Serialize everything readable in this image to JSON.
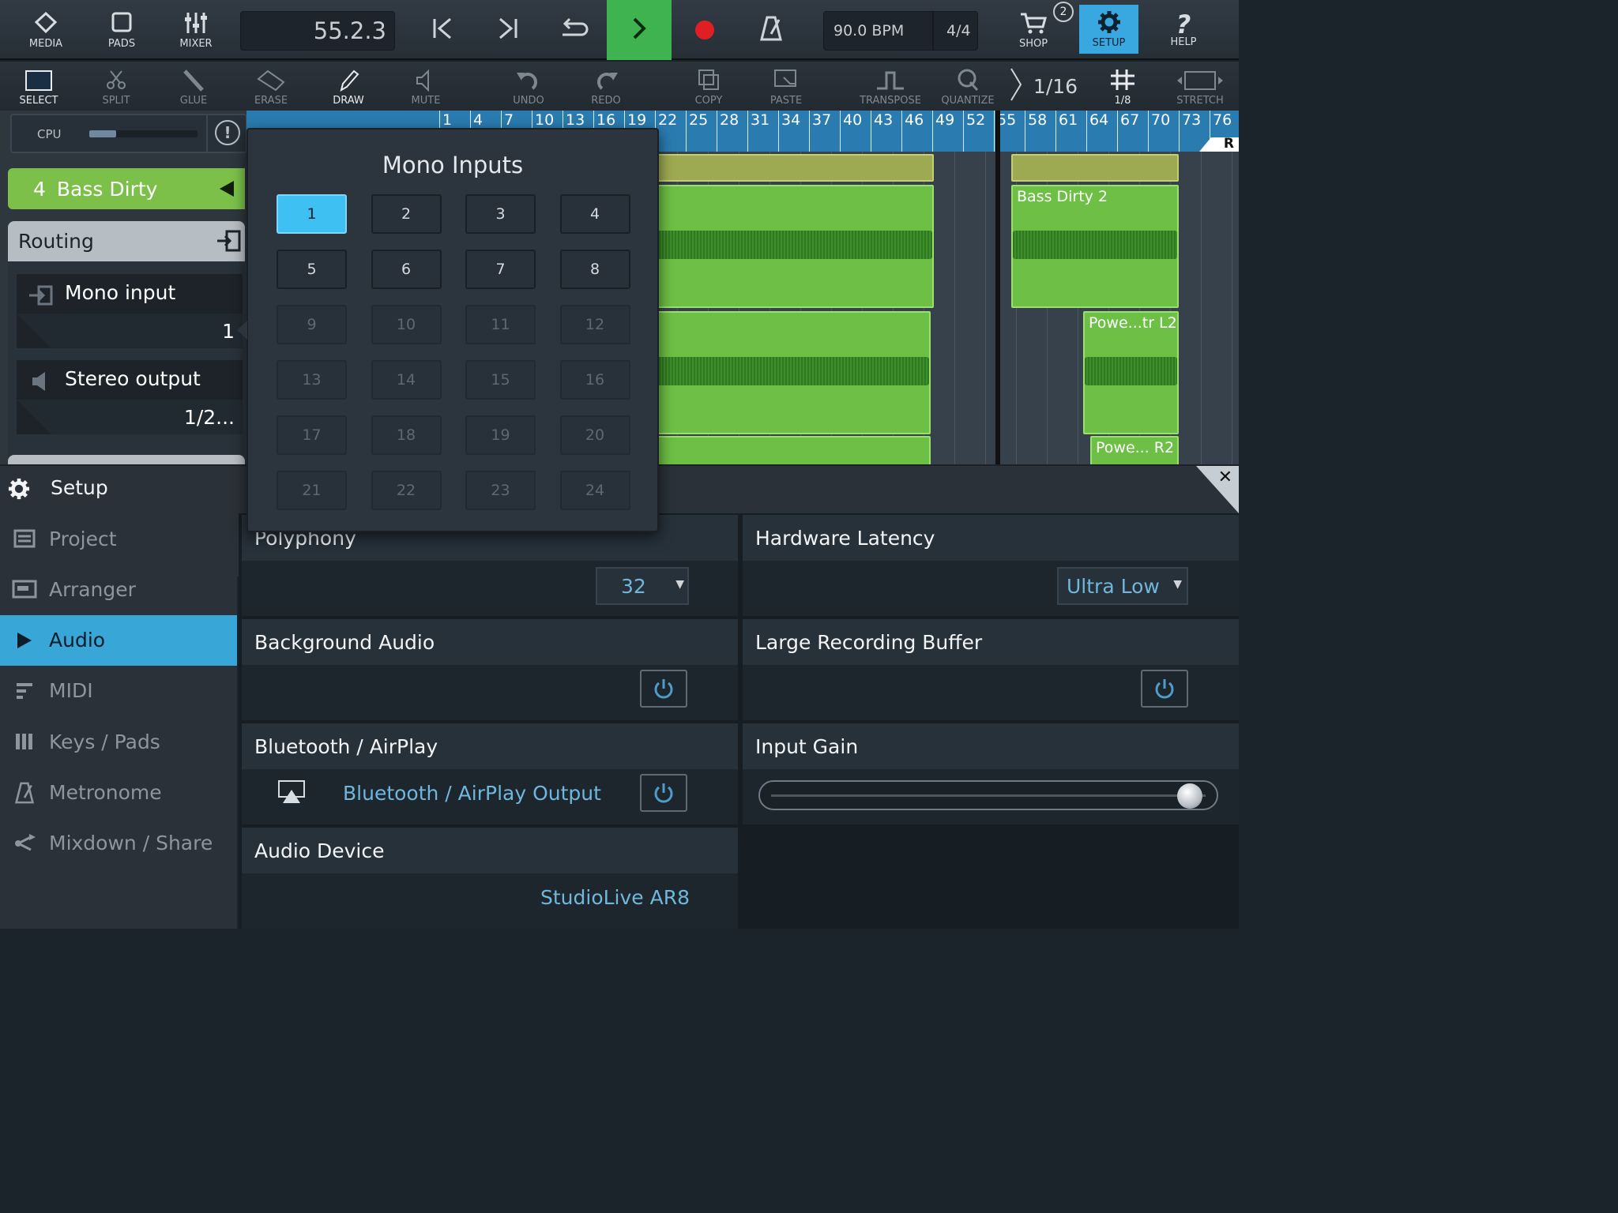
{
  "topbar": {
    "media": "MEDIA",
    "pads": "PADS",
    "mixer": "MIXER",
    "position": "55.2.3",
    "tempo": "90.0 BPM",
    "signature": "4/4",
    "shop": "SHOP",
    "shop_badge": "2",
    "setup": "SETUP",
    "help": "HELP"
  },
  "toolbar": {
    "select": "SELECT",
    "split": "SPLIT",
    "glue": "GLUE",
    "erase": "ERASE",
    "draw": "DRAW",
    "mute": "MUTE",
    "undo": "UNDO",
    "redo": "REDO",
    "copy": "COPY",
    "paste": "PASTE",
    "transpose": "TRANSPOSE",
    "quantize": "QUANTIZE",
    "quantize_value": "1/16",
    "grid_value": "1/8",
    "stretch": "STRETCH"
  },
  "track": {
    "cpu_label": "CPU",
    "cpu_level": 0.25,
    "number": "4",
    "name": "Bass Dirty",
    "routing_label": "Routing",
    "input_label": "Mono input",
    "input_value": "1",
    "output_label": "Stereo output",
    "output_value": "1/2..."
  },
  "ruler": {
    "bars": [
      "1",
      "4",
      "7",
      "10",
      "13",
      "16",
      "19",
      "22",
      "25",
      "28",
      "31",
      "34",
      "37",
      "40",
      "43",
      "46",
      "49",
      "52",
      "55",
      "58",
      "61",
      "64",
      "67",
      "70",
      "73",
      "76"
    ],
    "marker": "R"
  },
  "clips": {
    "bass_dirty_2": "Bass Dirty 2",
    "power_l2": "Powe...tr L2",
    "power_r2": "Powe... R2"
  },
  "popup": {
    "title": "Mono Inputs",
    "inputs": [
      "1",
      "2",
      "3",
      "4",
      "5",
      "6",
      "7",
      "8",
      "9",
      "10",
      "11",
      "12",
      "13",
      "14",
      "15",
      "16",
      "17",
      "18",
      "19",
      "20",
      "21",
      "22",
      "23",
      "24"
    ],
    "selected": "1",
    "enabled_count": 8
  },
  "setup": {
    "title": "Setup",
    "menu": [
      {
        "label": "Project",
        "icon": "project-icon"
      },
      {
        "label": "Arranger",
        "icon": "arranger-icon"
      },
      {
        "label": "Audio",
        "icon": "audio-icon"
      },
      {
        "label": "MIDI",
        "icon": "midi-icon"
      },
      {
        "label": "Keys / Pads",
        "icon": "keys-icon"
      },
      {
        "label": "Metronome",
        "icon": "metronome-icon"
      },
      {
        "label": "Mixdown / Share",
        "icon": "share-icon"
      }
    ],
    "active": "Audio"
  },
  "audio": {
    "polyphony_label": "Polyphony",
    "polyphony_value": "32",
    "latency_label": "Hardware Latency",
    "latency_value": "Ultra Low",
    "background_label": "Background Audio",
    "buffer_label": "Large Recording Buffer",
    "bluetooth_label": "Bluetooth / AirPlay",
    "bluetooth_output": "Bluetooth / AirPlay Output",
    "gain_label": "Input Gain",
    "gain_level": 0.97,
    "device_label": "Audio Device",
    "device_value": "StudioLive AR8"
  },
  "colors": {
    "accent_blue": "#39a6d8",
    "play_green": "#3fb34f",
    "track_green": "#7cc04a",
    "record_red": "#e01f25"
  }
}
